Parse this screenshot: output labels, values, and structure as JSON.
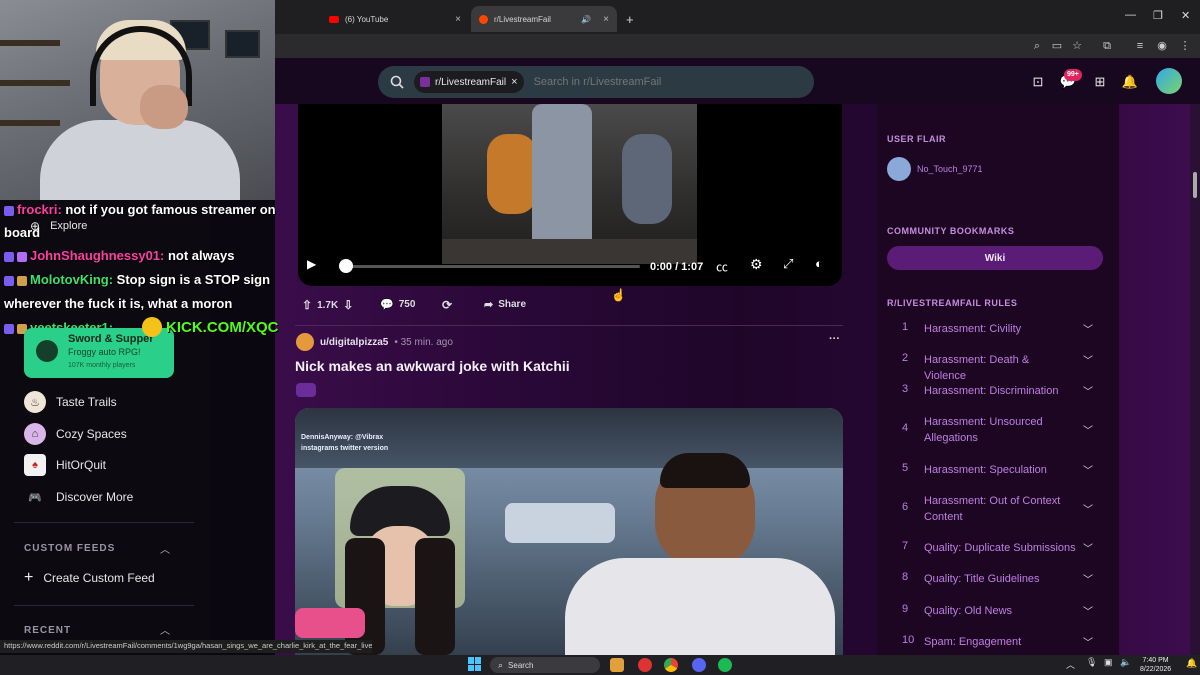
{
  "browser": {
    "tabs": [
      {
        "label": "(6) YouTube",
        "active": false
      },
      {
        "label": "r/LivestreamFail",
        "active": true
      }
    ],
    "new_tab_label": "+"
  },
  "header": {
    "search_chip": "r/LivestreamFail",
    "search_placeholder": "Search in r/LivestreamFail",
    "notification_count": "99+"
  },
  "chat": [
    {
      "user": "frockri:",
      "message": " not if you got famous streamer on",
      "user_color": "#ff3ea5"
    },
    {
      "user": "",
      "message": "board",
      "user_color": "#ffffff"
    },
    {
      "user": "JohnShaughnessy01:",
      "message": " not always",
      "user_color": "#ff3ea5"
    },
    {
      "user": "MolotovKing:",
      "message": " Stop sign is a STOP sign",
      "user_color": "#3ee06a"
    },
    {
      "user": "",
      "message": "wherever the fuck it is, what a moron",
      "user_color": "#ffffff"
    },
    {
      "user": "yeetskeeter1:",
      "message": "",
      "user_color": "#3ee06a"
    }
  ],
  "kick_badge": "KICK.COM/XQC",
  "sidebar": {
    "explore_label": "Explore",
    "game_card": {
      "title": "Sword & Supper",
      "subtitle": "Froggy auto RPG!",
      "meta": "107K monthly players"
    },
    "items": [
      {
        "label": "Taste Trails",
        "icon": "chef-hat-icon"
      },
      {
        "label": "Cozy Spaces",
        "icon": "house-icon"
      },
      {
        "label": "HitOrQuit",
        "icon": "card-icon"
      },
      {
        "label": "Discover More",
        "icon": "gamepad-icon"
      }
    ],
    "custom_feeds_heading": "CUSTOM FEEDS",
    "create_custom_feed": "Create Custom Feed",
    "recent_heading": "RECENT"
  },
  "video1": {
    "time": "0:00 / 1:07",
    "progress": 0.0
  },
  "post1_actions": {
    "votes": "1.7K",
    "comments": "750",
    "share": "Share"
  },
  "post2": {
    "author": "u/digitalpizza5",
    "time": "• 35 min. ago",
    "title": "Nick makes an awkward joke with Katchii",
    "more": "···",
    "chat_overlay": [
      "DennisAnyway: @Vibrax",
      "instagrams twitter version"
    ]
  },
  "right_sidebar": {
    "user_flair_heading": "USER FLAIR",
    "flair_user": "No_Touch_9771",
    "bookmarks_heading": "COMMUNITY BOOKMARKS",
    "wiki_label": "Wiki",
    "rules_heading": "R/LIVESTREAMFAIL RULES",
    "rules": [
      {
        "num": "1",
        "text": "Harassment: Civility"
      },
      {
        "num": "2",
        "text": "Harassment: Death & Violence"
      },
      {
        "num": "3",
        "text": "Harassment: Discrimination"
      },
      {
        "num": "4",
        "text": "Harassment: Unsourced Allegations"
      },
      {
        "num": "5",
        "text": "Harassment: Speculation"
      },
      {
        "num": "6",
        "text": "Harassment: Out of Context Content"
      },
      {
        "num": "7",
        "text": "Quality: Duplicate Submissions"
      },
      {
        "num": "8",
        "text": "Quality: Title Guidelines"
      },
      {
        "num": "9",
        "text": "Quality: Old News"
      },
      {
        "num": "10",
        "text": "Spam: Engagement"
      }
    ]
  },
  "status_url": "https://www.reddit.com/r/LivestreamFail/comments/1wg9ga/hasan_sings_we_are_charlie_kirk_at_the_fear_live/",
  "taskbar": {
    "search_label": "Search",
    "time": "7:40 PM",
    "date": "8/22/2026"
  },
  "colors": {
    "accent_purple": "#5b1c78",
    "rule_text": "#c07ee3",
    "game_card_green": "#2ad08a"
  }
}
